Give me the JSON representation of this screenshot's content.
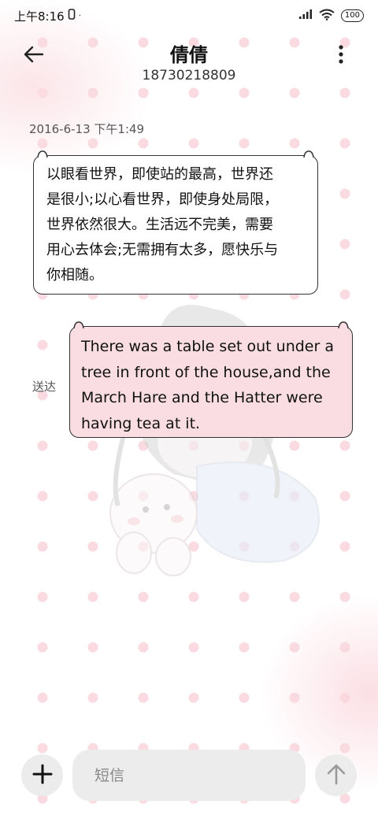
{
  "status_bar": {
    "time": "上午8:16",
    "battery": "100"
  },
  "header": {
    "contact_name": "倩倩",
    "phone_number": "18730218809",
    "icons": {
      "back": "arrow-left-icon",
      "more": "more-vertical-icon"
    }
  },
  "conversation": {
    "timestamp": "2016-6-13 下午1:49",
    "messages": [
      {
        "direction": "incoming",
        "lines": [
          "以眼看世界，即使站的最高，世界还",
          "是很小;以心看世界，即使身处局限，",
          "世界依然很大。生活远不完美，需要",
          "用心去体会;无需拥有太多，愿快乐与",
          "你相随。"
        ]
      },
      {
        "direction": "outgoing",
        "status": "送达",
        "lines": [
          "There was a table set out under a",
          "tree in front of the house,and the",
          "March Hare and the Hatter were",
          "having tea at it."
        ]
      }
    ]
  },
  "composer": {
    "placeholder": "短信",
    "icons": {
      "add": "plus-icon",
      "send": "arrow-up-icon"
    }
  },
  "colors": {
    "outgoing_bubble": "#f9dde3",
    "incoming_bubble": "#ffffff",
    "background_dots": "#f8d7de"
  }
}
